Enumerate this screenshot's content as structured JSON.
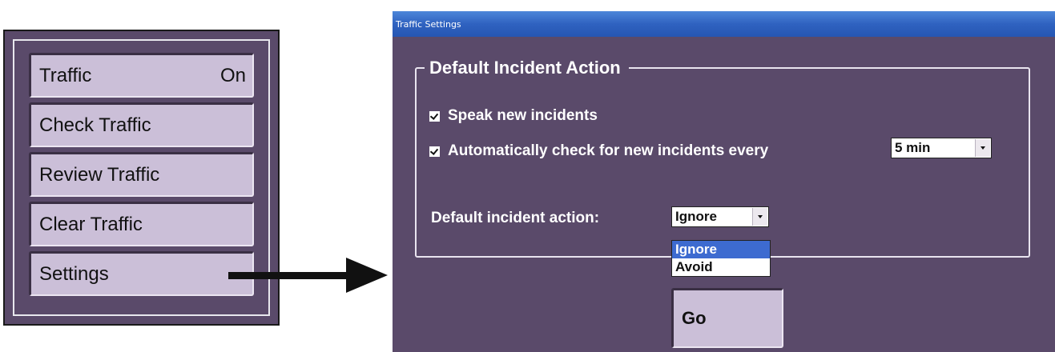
{
  "menu": {
    "items": [
      {
        "label": "Traffic",
        "state": "On"
      },
      {
        "label": "Check Traffic"
      },
      {
        "label": "Review Traffic"
      },
      {
        "label": "Clear Traffic"
      },
      {
        "label": "Settings"
      }
    ]
  },
  "dialog": {
    "title": "Traffic Settings",
    "group_title": "Default Incident Action",
    "speak_label": "Speak new incidents",
    "speak_checked": true,
    "auto_check_label": "Automatically check for new incidents every",
    "auto_check_checked": true,
    "interval_value": "5 min",
    "action_label": "Default incident action:",
    "action_value": "Ignore",
    "action_options": [
      "Ignore",
      "Avoid"
    ],
    "highlighted_option": "Ignore",
    "go_label": "Go"
  },
  "colors": {
    "panel": "#5a4a6a",
    "button": "#cbbfd8",
    "titlebar": "#2f62c0",
    "highlight": "#3d6bd0"
  },
  "icons": {
    "arrow": "arrow-right-icon",
    "dropdown": "chevron-down-icon",
    "checkbox": "checkmark-icon"
  }
}
